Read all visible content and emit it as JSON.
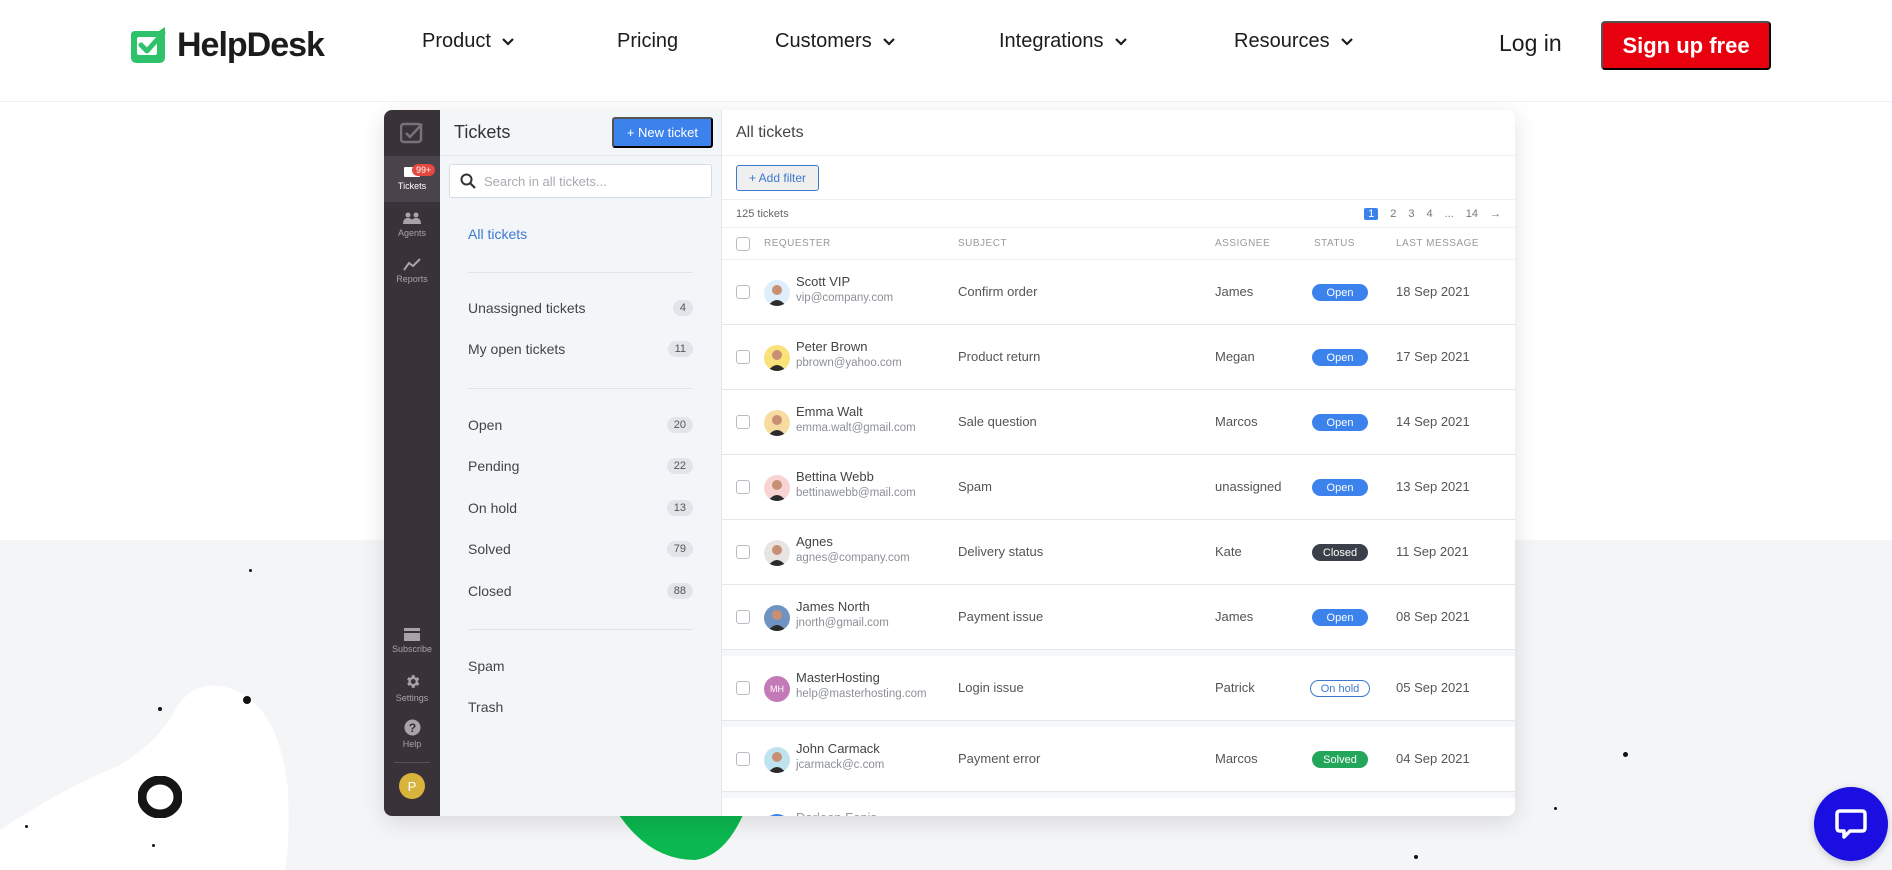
{
  "nav": {
    "brand": "HelpDesk",
    "items": [
      {
        "label": "Product",
        "has_dropdown": true
      },
      {
        "label": "Pricing",
        "has_dropdown": false
      },
      {
        "label": "Customers",
        "has_dropdown": true
      },
      {
        "label": "Integrations",
        "has_dropdown": true
      },
      {
        "label": "Resources",
        "has_dropdown": true
      }
    ],
    "login": "Log in",
    "signup": "Sign up free"
  },
  "colors": {
    "brand_green": "#2ec36b",
    "signup_red": "#e8000f",
    "primary_blue": "#3b82ec",
    "rail_bg": "#3a3239",
    "chat_blue": "#1a0ee0"
  },
  "rail": {
    "items": [
      {
        "label": "Tickets",
        "icon": "ticket-icon",
        "badge": "99+",
        "active": true
      },
      {
        "label": "Agents",
        "icon": "agents-icon"
      },
      {
        "label": "Reports",
        "icon": "reports-icon"
      }
    ],
    "bottom": [
      {
        "label": "Subscribe",
        "icon": "credit-card-icon"
      },
      {
        "label": "Settings",
        "icon": "gear-icon"
      },
      {
        "label": "Help",
        "icon": "help-icon"
      }
    ],
    "avatar_initial": "P"
  },
  "left_panel": {
    "title": "Tickets",
    "new_ticket": "+ New ticket",
    "search_placeholder": "Search in all tickets...",
    "all_tickets": "All tickets",
    "group1": [
      {
        "label": "Unassigned tickets",
        "count": "4"
      },
      {
        "label": "My open tickets",
        "count": "11"
      }
    ],
    "group2": [
      {
        "label": "Open",
        "count": "20"
      },
      {
        "label": "Pending",
        "count": "22"
      },
      {
        "label": "On hold",
        "count": "13"
      },
      {
        "label": "Solved",
        "count": "79"
      },
      {
        "label": "Closed",
        "count": "88"
      }
    ],
    "group3": [
      {
        "label": "Spam"
      },
      {
        "label": "Trash"
      }
    ]
  },
  "main": {
    "title": "All tickets",
    "add_filter": "+ Add filter",
    "ticket_count": "125 tickets",
    "pagination": {
      "current": "1",
      "pages": [
        "2",
        "3",
        "4"
      ],
      "ellipsis": "...",
      "last": "14",
      "next": "→"
    },
    "columns": [
      "REQUESTER",
      "SUBJECT",
      "ASSIGNEE",
      "STATUS",
      "LAST MESSAGE"
    ],
    "rows": [
      {
        "name": "Scott VIP",
        "email": "vip@company.com",
        "subject": "Confirm order",
        "assignee": "James",
        "status": "Open",
        "last": "18 Sep 2021"
      },
      {
        "name": "Peter Brown",
        "email": "pbrown@yahoo.com",
        "subject": "Product return",
        "assignee": "Megan",
        "status": "Open",
        "last": "17 Sep 2021"
      },
      {
        "name": "Emma Walt",
        "email": "emma.walt@gmail.com",
        "subject": "Sale question",
        "assignee": "Marcos",
        "status": "Open",
        "last": "14 Sep 2021"
      },
      {
        "name": "Bettina Webb",
        "email": "bettinawebb@mail.com",
        "subject": "Spam",
        "assignee": "unassigned",
        "status": "Open",
        "last": "13 Sep 2021"
      },
      {
        "name": "Agnes",
        "email": "agnes@company.com",
        "subject": "Delivery status",
        "assignee": "Kate",
        "status": "Closed",
        "last": "11 Sep 2021"
      },
      {
        "name": "James North",
        "email": "jnorth@gmail.com",
        "subject": "Payment issue",
        "assignee": "James",
        "status": "Open",
        "last": "08 Sep 2021"
      },
      {
        "name": "MasterHosting",
        "email": "help@masterhosting.com",
        "subject": "Login issue",
        "assignee": "Patrick",
        "status": "On hold",
        "last": "05 Sep 2021",
        "initials": "MH"
      },
      {
        "name": "John Carmack",
        "email": "jcarmack@c.com",
        "subject": "Payment error",
        "assignee": "Marcos",
        "status": "Solved",
        "last": "04 Sep 2021"
      }
    ],
    "partial_row_name": "Darleen Fonis"
  }
}
